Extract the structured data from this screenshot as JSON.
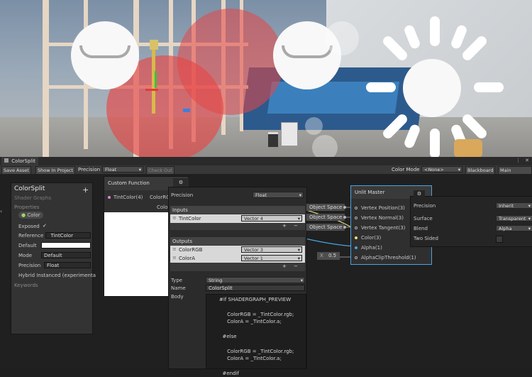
{
  "window": {
    "tab_title": "ColorSplit"
  },
  "toolbar": {
    "save_asset": "Save Asset",
    "show_in_project": "Show In Project",
    "precision_label": "Precision",
    "precision_value": "Float",
    "check_out": "Check Out",
    "color_mode_label": "Color Mode",
    "color_mode_value": "<None>",
    "blackboard": "Blackboard",
    "main_preview": "Main Preview"
  },
  "blackboard": {
    "title": "ColorSplit",
    "subtitle": "Shader Graphs",
    "add_symbol": "+",
    "properties_header": "Properties",
    "property_name": "Color",
    "rows": [
      {
        "label": "Exposed",
        "value": "✓"
      },
      {
        "label": "Reference",
        "value": "_TintColor"
      },
      {
        "label": "Default",
        "value": ""
      },
      {
        "label": "Mode",
        "value": "Default"
      },
      {
        "label": "Precision",
        "value": "Float"
      }
    ],
    "hybrid_instanced": "Hybrid Instanced (experimenta",
    "keywords_header": "Keywords"
  },
  "custom_function": {
    "title": "Custom Function",
    "input_port": "TintColor(4)",
    "output_ports": [
      "ColorRGB",
      "ColorA"
    ]
  },
  "custom_inspector": {
    "precision_label": "Precision",
    "precision_value": "Float",
    "inputs_header": "Inputs",
    "inputs": [
      {
        "name": "TintColor",
        "type": "Vector 4"
      }
    ],
    "outputs_header": "Outputs",
    "outputs": [
      {
        "name": "ColorRGB",
        "type": "Vector 3"
      },
      {
        "name": "ColorA",
        "type": "Vector 1"
      }
    ],
    "plus": "+",
    "minus": "−",
    "type_label": "Type",
    "type_value": "String",
    "name_label": "Name",
    "name_value": "ColorSplit",
    "body_label": "Body",
    "body_code": "#if SHADERGRAPH_PREVIEW\n\n     ColorRGB = _TintColor.rgb;\n     ColorA = _TintColor.a;\n\n  #else\n\n     ColorRGB = _TintColor.rgb;\n     ColorA = _TintColor.a;\n\n  #endif"
  },
  "object_space": [
    "Object Space",
    "Object Space",
    "Object Space"
  ],
  "unlit_master": {
    "title": "Unlit Master",
    "ports": [
      "Vertex Position(3)",
      "Vertex Normal(3)",
      "Vertex Tangent(3)",
      "Color(3)",
      "Alpha(1)",
      "AlphaClipThreshold(1)"
    ],
    "alpha_clip_prefix": "X",
    "alpha_clip_value": "0.5"
  },
  "master_settings": {
    "rows": [
      {
        "label": "Precision",
        "value": "Inherit"
      },
      {
        "label": "Surface",
        "value": "Transparent"
      },
      {
        "label": "Blend",
        "value": "Alpha"
      },
      {
        "label": "Two Sided",
        "value": ""
      }
    ]
  },
  "colors": {
    "accent_blue": "#4aa3df",
    "color_port": "#d98ad0",
    "wire_yellow": "#e8e07a"
  }
}
